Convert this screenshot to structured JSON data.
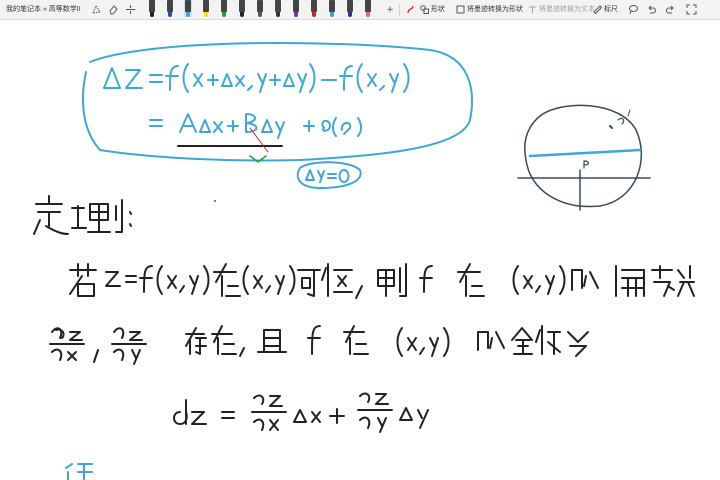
{
  "window": {
    "title": "我的笔记本 » 高等数学II"
  },
  "toolbar": {
    "pens": [
      {
        "name": "pen-black",
        "color": "#222222"
      },
      {
        "name": "pen-blue",
        "color": "#1f4fb5"
      },
      {
        "name": "pen-lightblue",
        "color": "#3fa7d6"
      },
      {
        "name": "pen-yellow",
        "color": "#f5e000"
      },
      {
        "name": "pen-green",
        "color": "#1aa52a"
      },
      {
        "name": "pen-black2",
        "color": "#222222"
      },
      {
        "name": "pen-gray",
        "color": "#555555"
      },
      {
        "name": "pen-darkgray",
        "color": "#333333"
      },
      {
        "name": "pen-purple",
        "color": "#7a2fb0"
      },
      {
        "name": "pen-red",
        "color": "#d82020"
      },
      {
        "name": "pen-cyan",
        "color": "#2aa8c8"
      },
      {
        "name": "pen-navy",
        "color": "#1a3c8a"
      },
      {
        "name": "pen-pink",
        "color": "#e060a0"
      }
    ],
    "shape_label": "形状",
    "ink_to_shape_label": "将墨迹转换为形状",
    "ink_to_text_label": "将墨迹转换为文本",
    "ruler_label": "标尺"
  },
  "accent": "#3fa7d6"
}
